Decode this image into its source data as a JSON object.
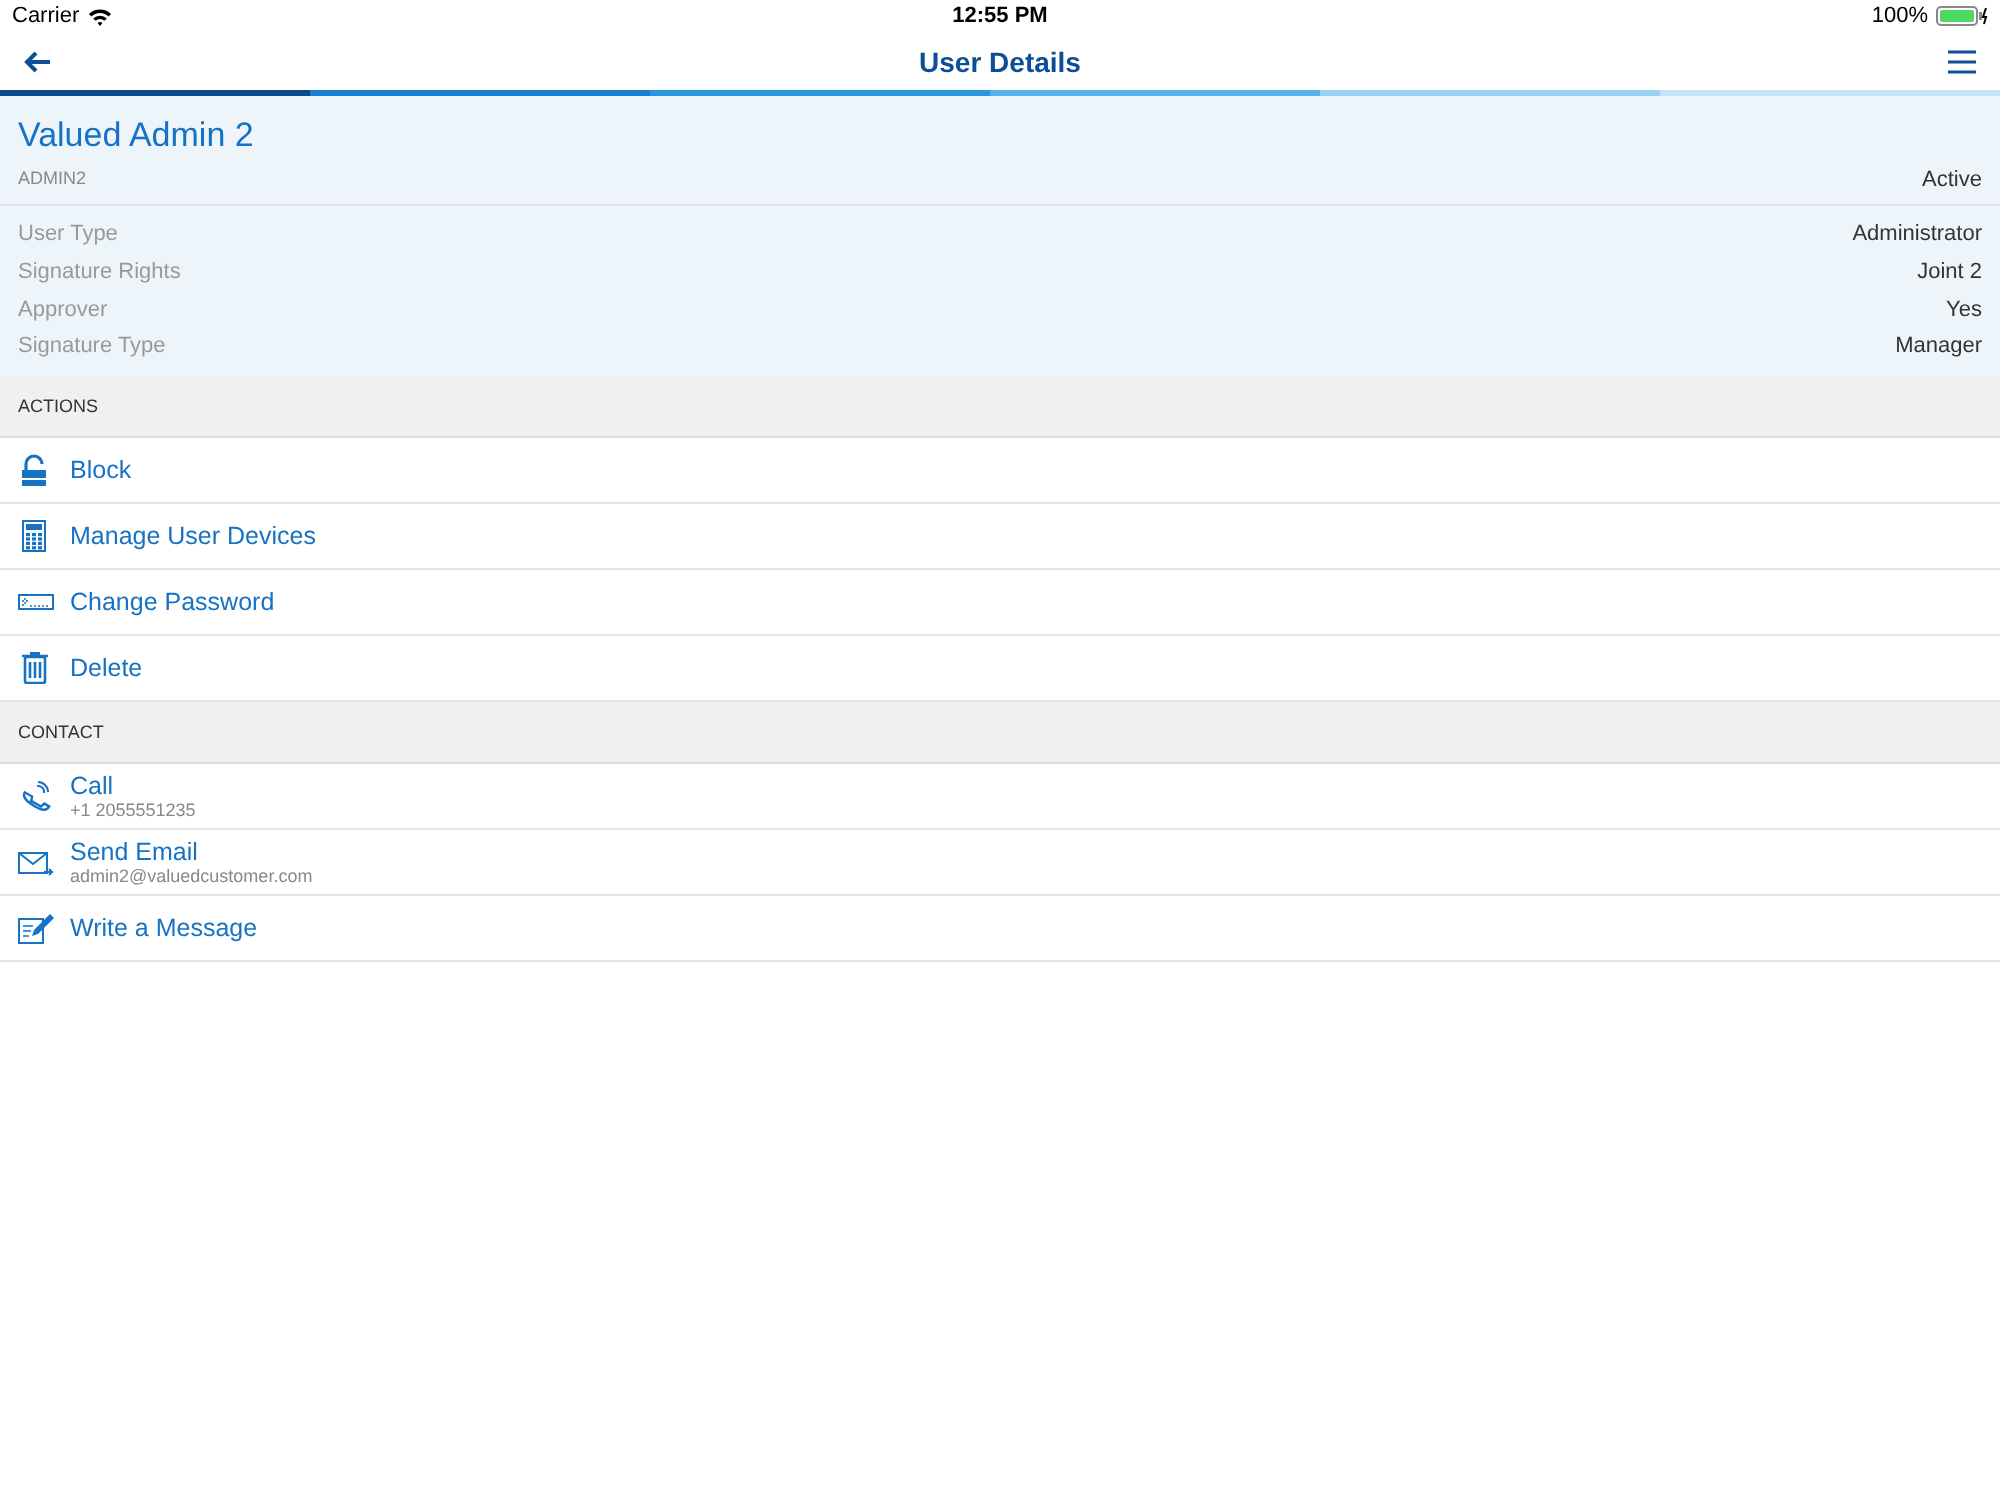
{
  "status_bar": {
    "carrier": "Carrier",
    "time": "12:55 PM",
    "battery": "100%"
  },
  "nav_bar": {
    "title": "User Details"
  },
  "user": {
    "name": "Valued Admin 2",
    "username": "ADMIN2",
    "status": "Active",
    "details": [
      {
        "label": "User Type",
        "value": "Administrator"
      },
      {
        "label": "Signature Rights",
        "value": "Joint 2"
      },
      {
        "label": "Approver",
        "value": "Yes"
      },
      {
        "label": "Signature Type",
        "value": "Manager"
      }
    ]
  },
  "sections": [
    {
      "title": "ACTIONS",
      "items": [
        {
          "label": "Block"
        },
        {
          "label": "Manage User Devices"
        },
        {
          "label": "Change Password"
        },
        {
          "label": "Delete"
        }
      ]
    },
    {
      "title": "CONTACT",
      "items": [
        {
          "label": "Call",
          "detail": "+1 2055551235"
        },
        {
          "label": "Send Email",
          "detail": "admin2@valuedcustomer.com"
        },
        {
          "label": "Write a Message"
        }
      ]
    }
  ]
}
